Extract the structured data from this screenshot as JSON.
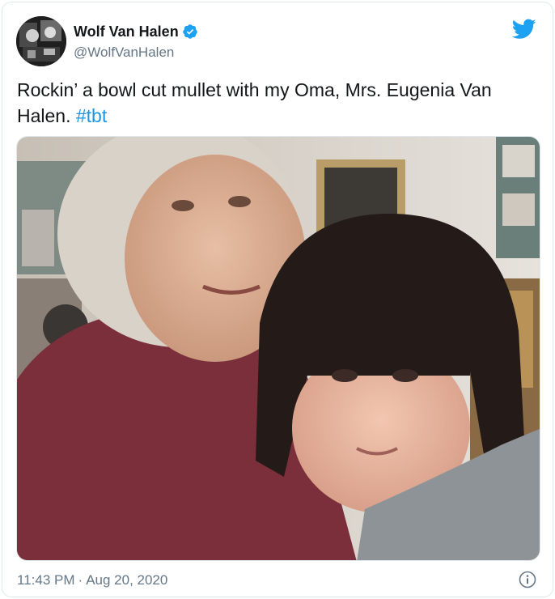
{
  "author": {
    "name": "Wolf Van Halen",
    "handle": "@WolfVanHalen",
    "verified": true
  },
  "tweet": {
    "text": "Rockin’ a bowl cut mullet with my Oma, Mrs. Eugenia Van Halen.",
    "hashtag": "#tbt"
  },
  "footer": {
    "time": "11:43 PM",
    "separator": "·",
    "date": "Aug 20, 2020"
  },
  "colors": {
    "twitter_blue": "#1da1f2",
    "hashtag": "#1b95e0",
    "muted": "#657786"
  },
  "icons": {
    "brand": "twitter-bird-icon",
    "verified": "verified-badge-icon",
    "info": "info-icon"
  }
}
